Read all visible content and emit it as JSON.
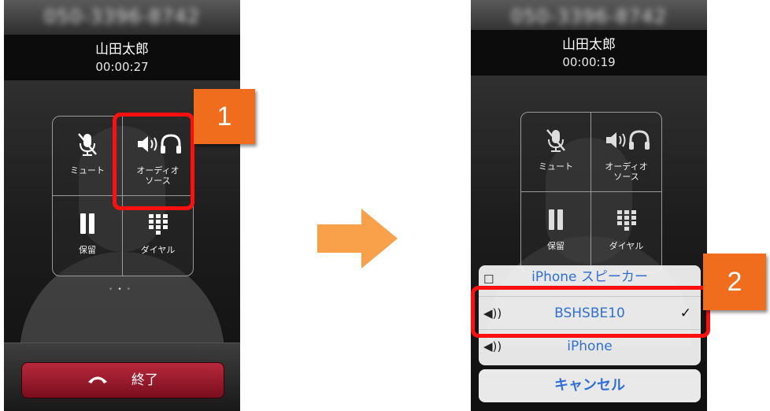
{
  "phone1": {
    "number": "050-3396-8742",
    "caller_name": "山田太郎",
    "duration": "00:00:27",
    "buttons": {
      "mute": "ミュート",
      "audio_line1": "オーディオ",
      "audio_line2": "ソース",
      "hold": "保留",
      "dial": "ダイヤル"
    },
    "end_call": "終了"
  },
  "phone2": {
    "number": "050-3396-8742",
    "caller_name": "山田太郎",
    "duration": "00:00:19",
    "buttons": {
      "mute": "ミュート",
      "audio_line1": "オーディオ",
      "audio_line2": "ソース",
      "hold": "保留",
      "dial": "ダイヤル"
    },
    "audio_sheet": {
      "options": [
        "iPhone スピーカー",
        "BSHSBE10",
        "iPhone"
      ],
      "selected": "BSHSBE10",
      "cancel": "キャンセル"
    }
  },
  "steps": [
    "1",
    "2"
  ],
  "colors": {
    "highlight": "#ff1010",
    "badge": "#f06d1e",
    "arrow": "#f8a04a",
    "end_button": "#9a1a2c",
    "sheet_text": "#2f6fd6"
  },
  "icons": [
    "mute-mic-icon",
    "speaker-headphone-icon",
    "pause-icon",
    "keypad-icon",
    "phone-hangup-icon",
    "speaker-icon",
    "checkmark-icon",
    "arrow-right-icon"
  ]
}
